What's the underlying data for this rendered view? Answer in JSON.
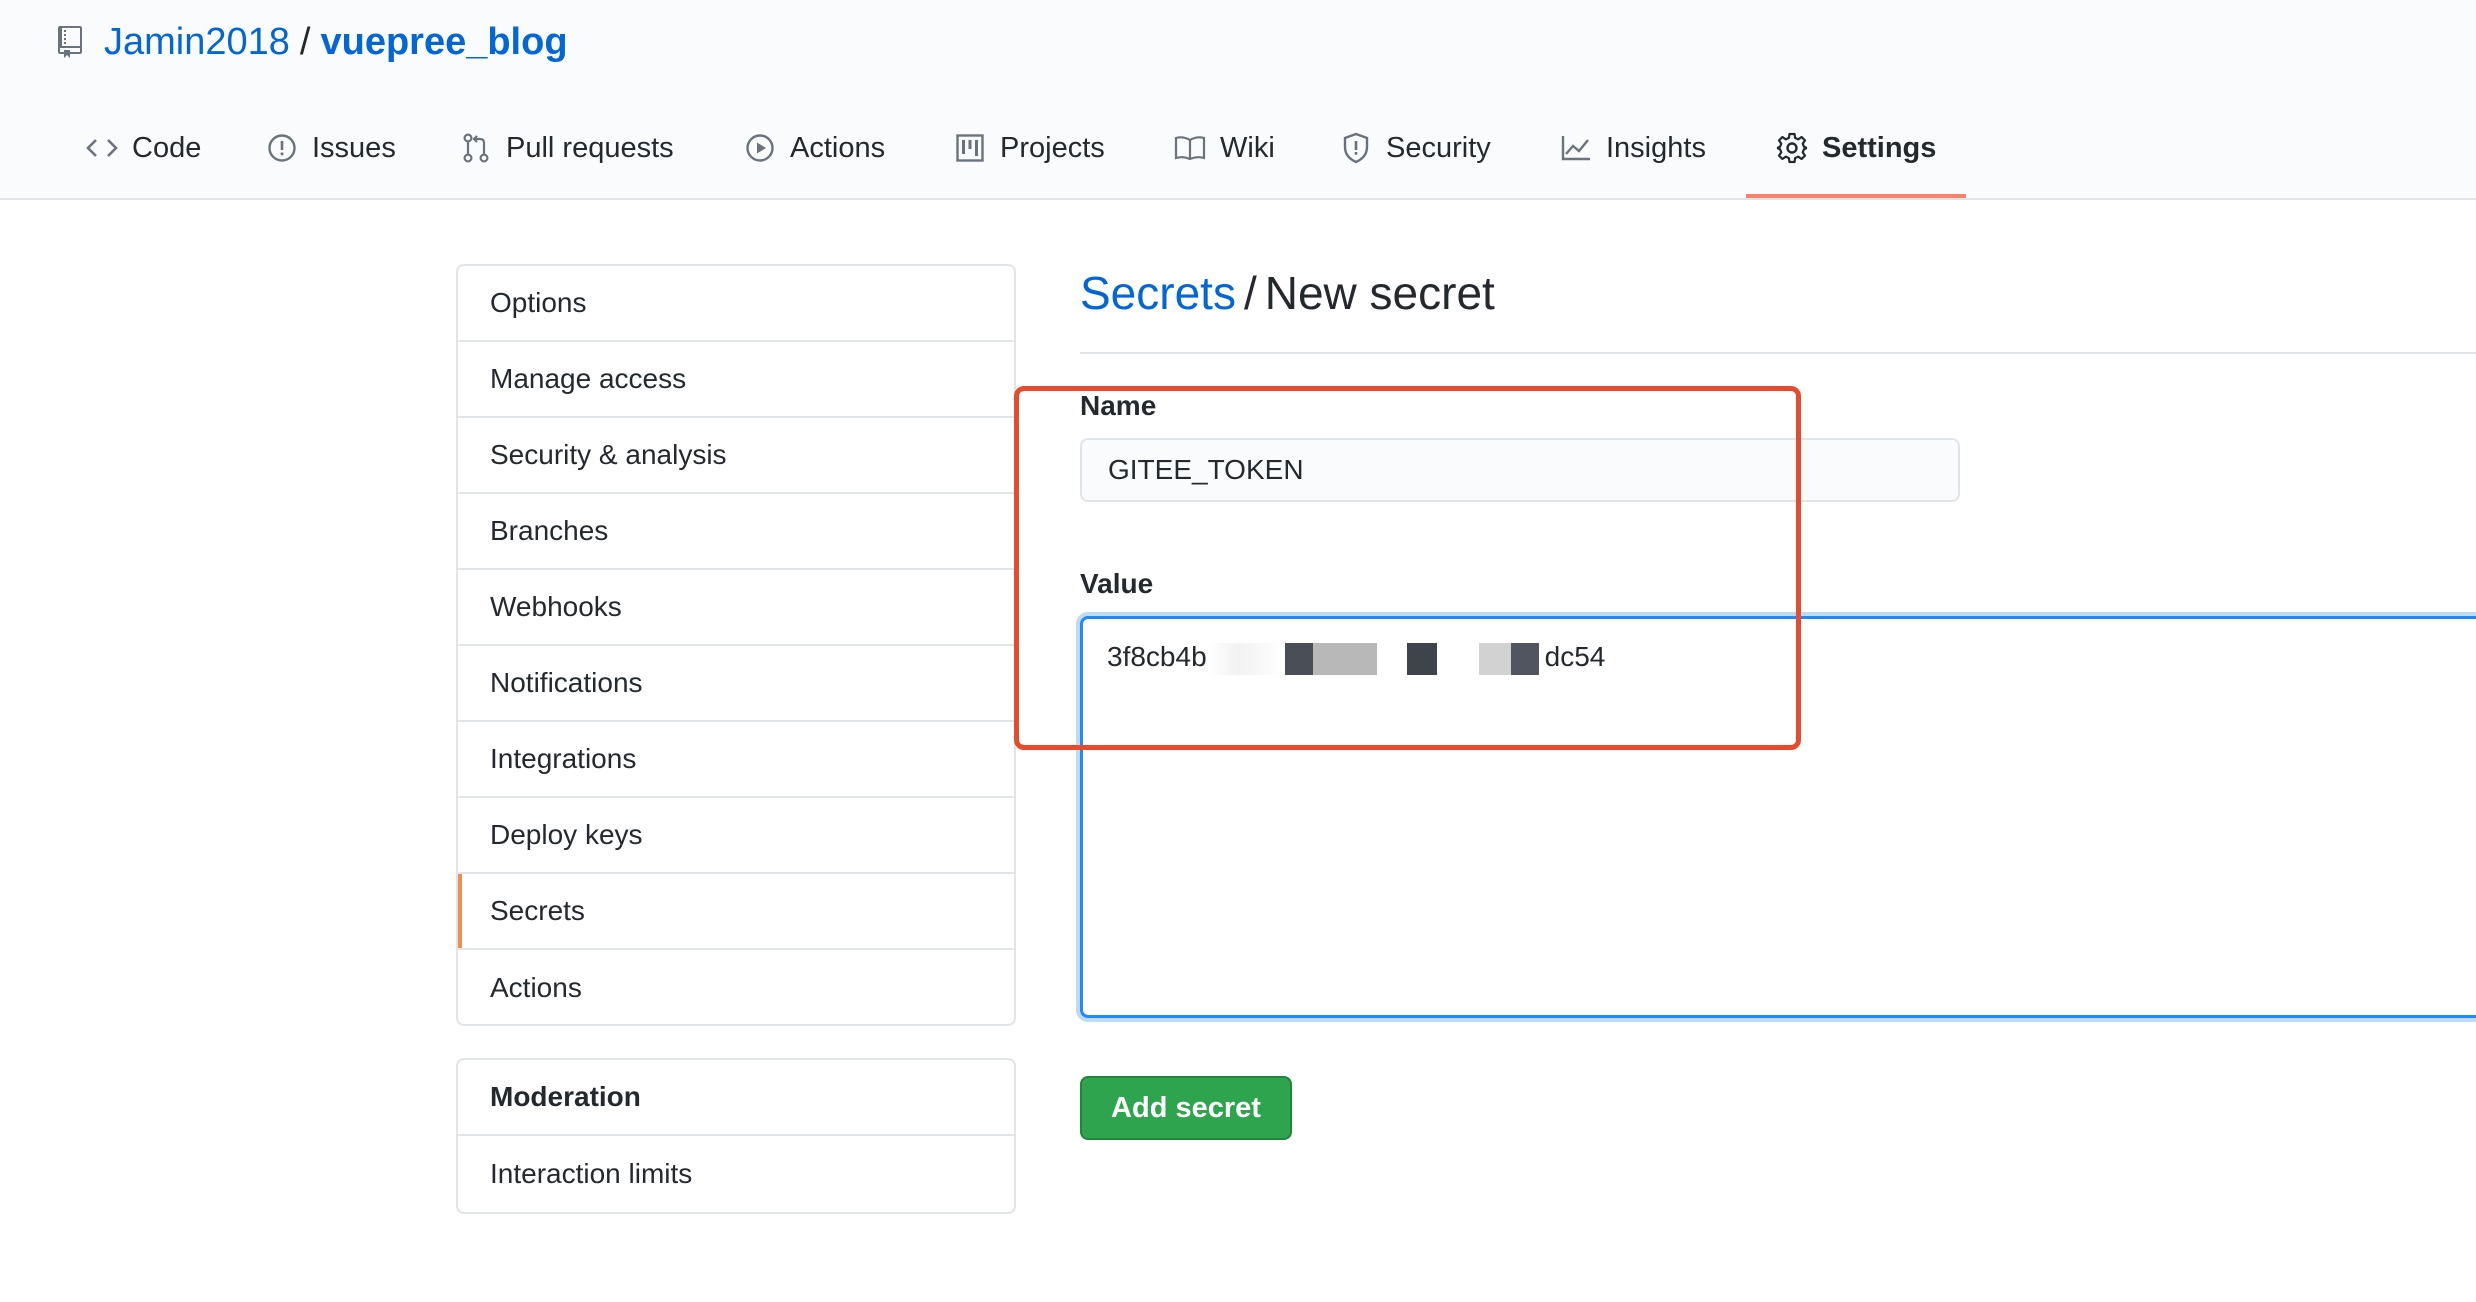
{
  "repo": {
    "owner": "Jamin2018",
    "separator": "/",
    "name": "vuepree_blog"
  },
  "tabs": [
    {
      "label": "Code",
      "icon": "code-icon"
    },
    {
      "label": "Issues",
      "icon": "issue-opened-icon"
    },
    {
      "label": "Pull requests",
      "icon": "git-pull-request-icon"
    },
    {
      "label": "Actions",
      "icon": "play-icon"
    },
    {
      "label": "Projects",
      "icon": "project-icon"
    },
    {
      "label": "Wiki",
      "icon": "book-icon"
    },
    {
      "label": "Security",
      "icon": "shield-icon"
    },
    {
      "label": "Insights",
      "icon": "graph-icon"
    },
    {
      "label": "Settings",
      "icon": "gear-icon",
      "selected": true
    }
  ],
  "sidebar": {
    "items": [
      {
        "label": "Options"
      },
      {
        "label": "Manage access"
      },
      {
        "label": "Security & analysis"
      },
      {
        "label": "Branches"
      },
      {
        "label": "Webhooks"
      },
      {
        "label": "Notifications"
      },
      {
        "label": "Integrations"
      },
      {
        "label": "Deploy keys"
      },
      {
        "label": "Secrets",
        "selected": true
      },
      {
        "label": "Actions"
      }
    ],
    "moderation": {
      "heading": "Moderation",
      "items": [
        {
          "label": "Interaction limits"
        }
      ]
    }
  },
  "page": {
    "breadcrumb_link": "Secrets",
    "separator": "/",
    "title": "New secret"
  },
  "form": {
    "name_label": "Name",
    "name_value": "GITEE_TOKEN",
    "value_label": "Value",
    "value_prefix": "3f8cb4b",
    "value_suffix": "dc54",
    "submit_label": "Add secret"
  },
  "colors": {
    "link": "#0366d6",
    "button": "#2ea44f",
    "highlight": "#e84a2c",
    "tab_underline": "#f9826c",
    "focus": "#2188ff"
  }
}
